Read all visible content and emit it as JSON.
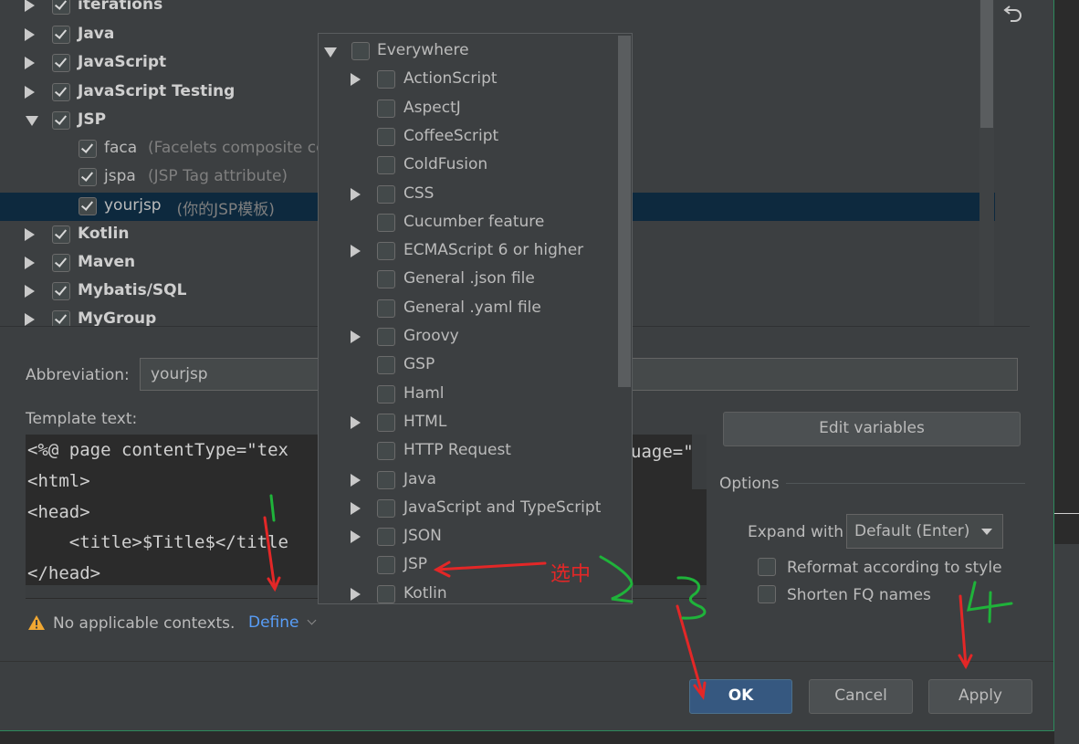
{
  "tree": {
    "items": [
      {
        "label": "iterations",
        "hint": "",
        "expanded": false,
        "checked": true,
        "bold": true
      },
      {
        "label": "Java",
        "hint": "",
        "expanded": false,
        "checked": true,
        "bold": true
      },
      {
        "label": "JavaScript",
        "hint": "",
        "expanded": false,
        "checked": true,
        "bold": true
      },
      {
        "label": "JavaScript Testing",
        "hint": "",
        "expanded": false,
        "checked": true,
        "bold": true
      },
      {
        "label": "JSP",
        "hint": "",
        "expanded": true,
        "checked": true,
        "bold": true
      },
      {
        "label": "faca",
        "hint": "(Facelets composite cor",
        "checked": true,
        "bold": false
      },
      {
        "label": "jspa",
        "hint": "(JSP Tag attribute)",
        "checked": true,
        "bold": false
      },
      {
        "label": "yourjsp",
        "hint": "(你的JSP模板)",
        "checked": true,
        "bold": false,
        "selected": true
      },
      {
        "label": "Kotlin",
        "hint": "",
        "expanded": false,
        "checked": true,
        "bold": true
      },
      {
        "label": "Maven",
        "hint": "",
        "expanded": false,
        "checked": true,
        "bold": true
      },
      {
        "label": "Mybatis/SQL",
        "hint": "",
        "expanded": false,
        "checked": true,
        "bold": true
      },
      {
        "label": "MyGroup",
        "hint": "",
        "expanded": false,
        "checked": true,
        "bold": true
      }
    ]
  },
  "abbreviation": {
    "label": "Abbreviation:",
    "value": "yourjsp"
  },
  "template": {
    "label": "Template text:",
    "lines": [
      "<%@ page contentType=\"tex",
      "<html>",
      "<head>",
      "    <title>$Title$</title",
      "</head>"
    ],
    "right_fragment": "uage=\"j"
  },
  "edit_variables_label": "Edit variables",
  "options": {
    "title": "Options",
    "expand_label": "Expand with",
    "expand_value": "Default (Enter)",
    "reformat_label": "Reformat according to style",
    "shorten_label": "Shorten FQ names"
  },
  "context": {
    "warning": "No applicable contexts.",
    "define_label": "Define"
  },
  "buttons": {
    "ok": "OK",
    "cancel": "Cancel",
    "apply": "Apply"
  },
  "popup": {
    "items": [
      {
        "label": "Everywhere",
        "arrow": "down"
      },
      {
        "label": "ActionScript",
        "arrow": "right"
      },
      {
        "label": "AspectJ",
        "arrow": ""
      },
      {
        "label": "CoffeeScript",
        "arrow": ""
      },
      {
        "label": "ColdFusion",
        "arrow": ""
      },
      {
        "label": "CSS",
        "arrow": "right"
      },
      {
        "label": "Cucumber feature",
        "arrow": ""
      },
      {
        "label": "ECMAScript 6 or higher",
        "arrow": "right"
      },
      {
        "label": "General .json file",
        "arrow": ""
      },
      {
        "label": "General .yaml file",
        "arrow": ""
      },
      {
        "label": "Groovy",
        "arrow": "right"
      },
      {
        "label": "GSP",
        "arrow": ""
      },
      {
        "label": "Haml",
        "arrow": ""
      },
      {
        "label": "HTML",
        "arrow": "right"
      },
      {
        "label": "HTTP Request",
        "arrow": ""
      },
      {
        "label": "Java",
        "arrow": "right"
      },
      {
        "label": "JavaScript and TypeScript",
        "arrow": "right"
      },
      {
        "label": "JSON",
        "arrow": "right"
      },
      {
        "label": "JSP",
        "arrow": ""
      },
      {
        "label": "Kotlin",
        "arrow": "right"
      }
    ]
  },
  "annotations": {
    "select_text": "选中",
    "colors": {
      "red": "#e32727",
      "green": "#1fb33a"
    }
  },
  "icons": {
    "undo": "undo-icon",
    "warning": "warning-icon",
    "dropdown": "chevron-down-icon"
  }
}
